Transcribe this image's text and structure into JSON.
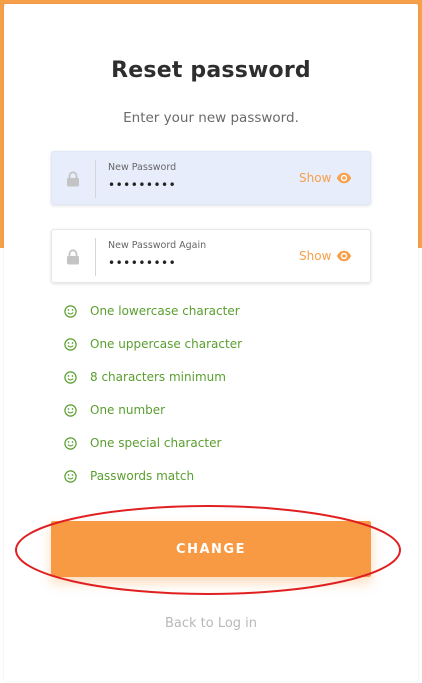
{
  "page": {
    "title": "Reset password",
    "subtitle": "Enter your new password."
  },
  "fields": [
    {
      "label": "New Password",
      "value": "•••••••••",
      "show_label": "Show",
      "state": "focused",
      "icon": "lock-icon"
    },
    {
      "label": "New Password Again",
      "value": "•••••••••",
      "show_label": "Show",
      "state": "idle",
      "icon": "lock-icon"
    }
  ],
  "requirements": [
    {
      "text": "One lowercase character",
      "status": "met"
    },
    {
      "text": "One uppercase character",
      "status": "met"
    },
    {
      "text": "8 characters minimum",
      "status": "met"
    },
    {
      "text": "One number",
      "status": "met"
    },
    {
      "text": "One special character",
      "status": "met"
    },
    {
      "text": "Passwords match",
      "status": "met"
    }
  ],
  "actions": {
    "submit_label": "CHANGE",
    "back_label": "Back to Log in"
  },
  "colors": {
    "accent": "#f79a43",
    "success": "#5a9e2f",
    "highlight_ring": "#e02020",
    "focused_field_bg": "#e7edfb"
  }
}
